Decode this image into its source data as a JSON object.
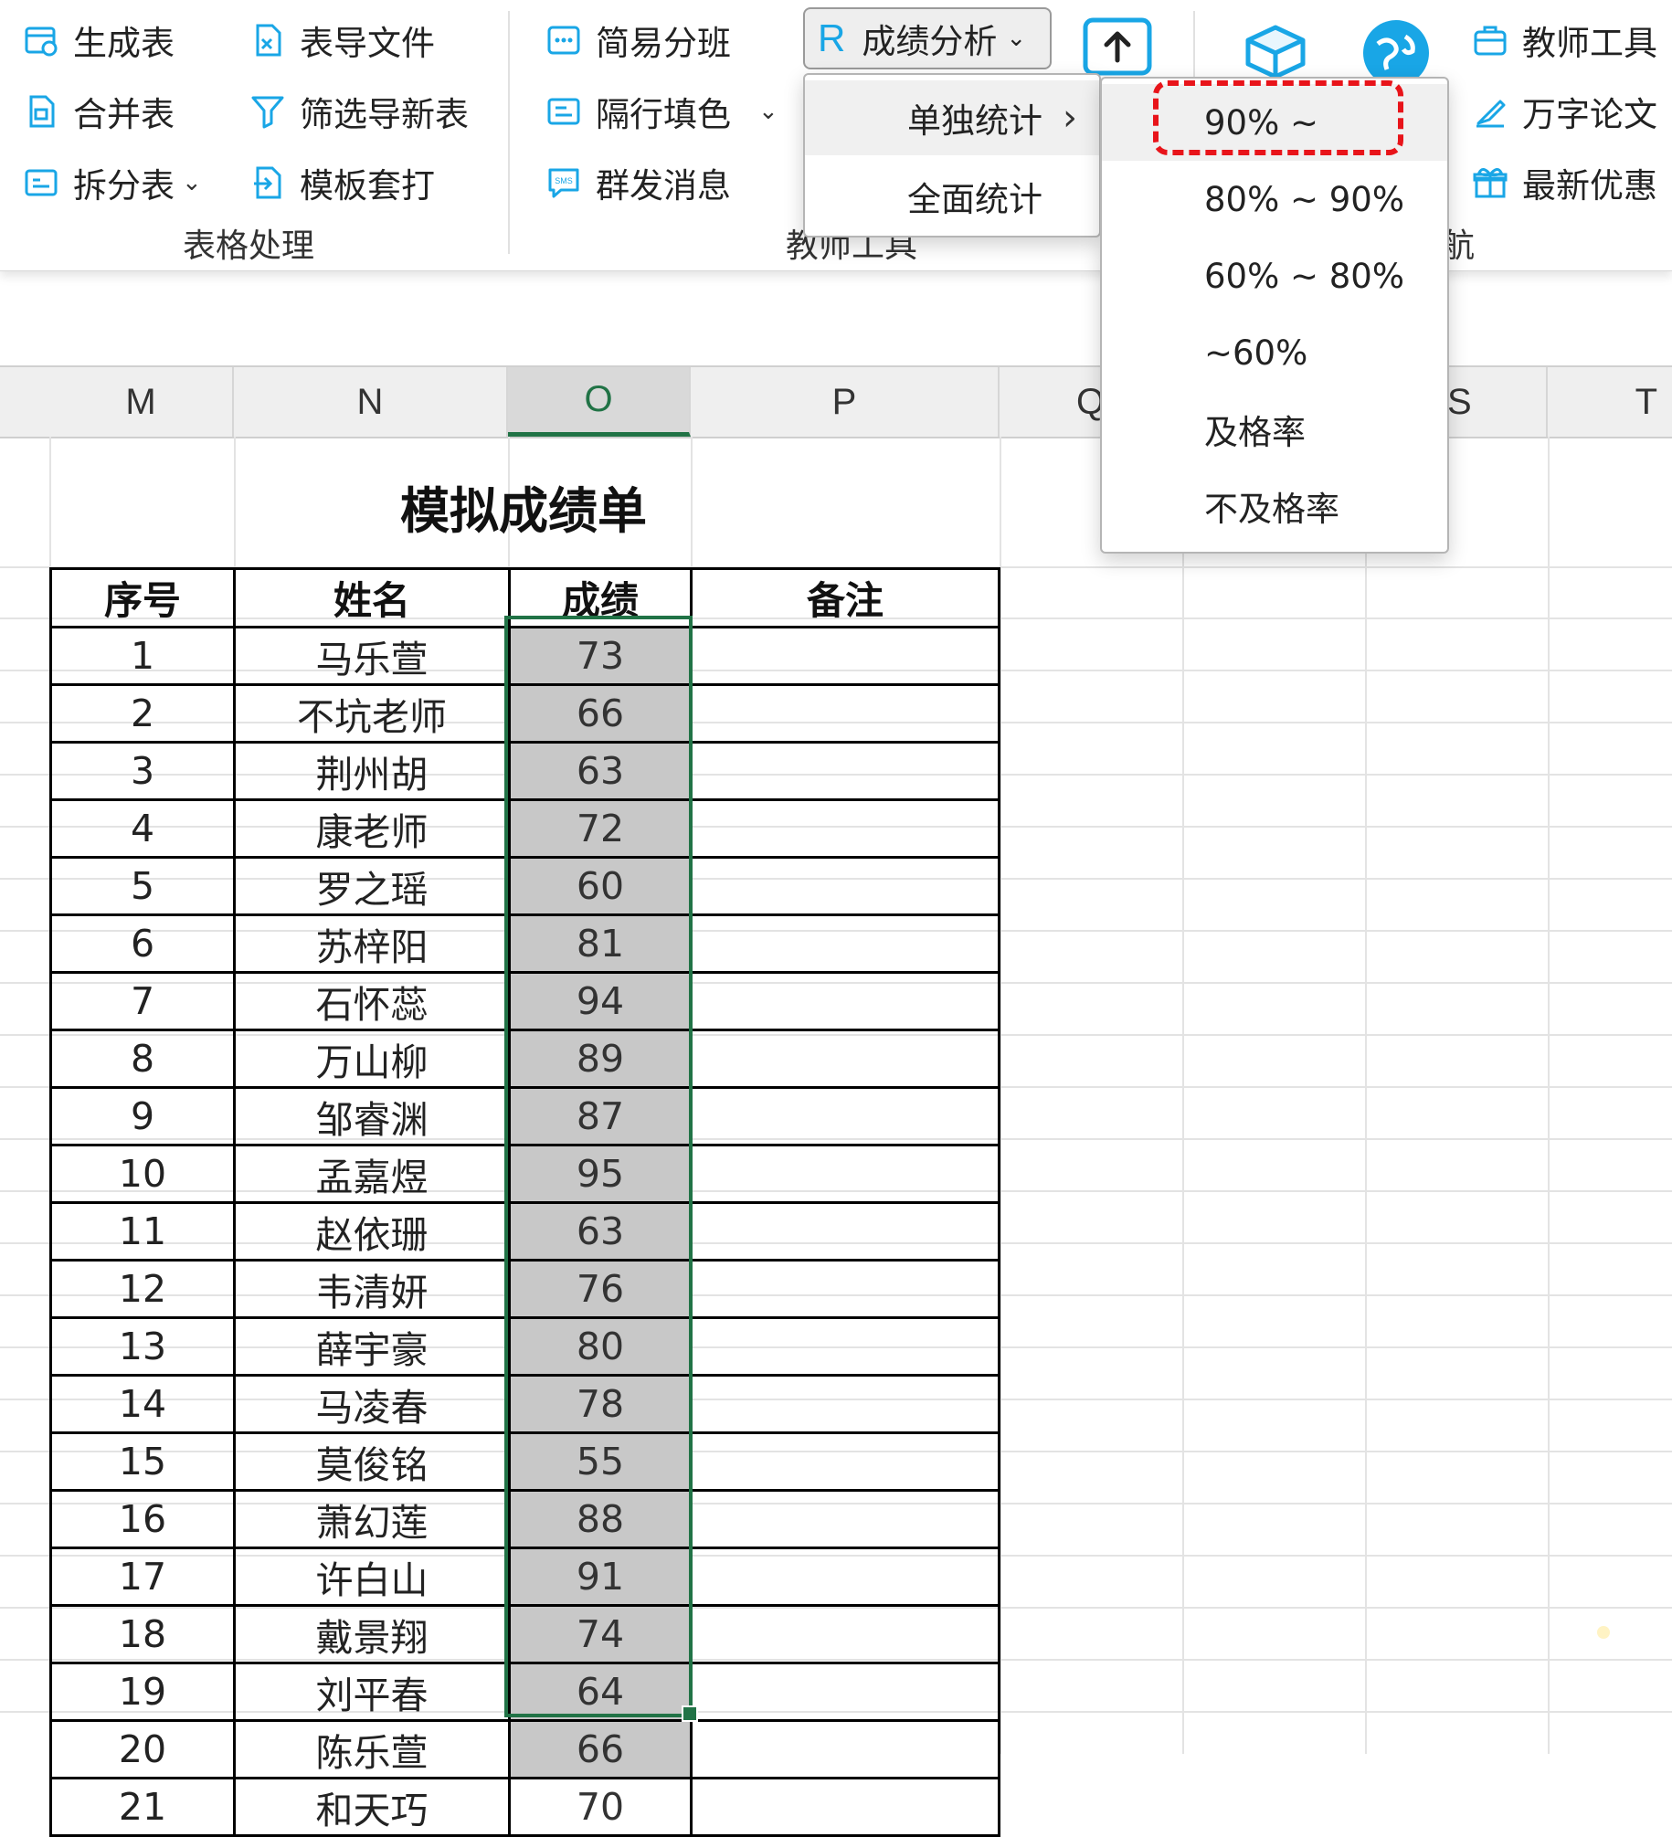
{
  "ribbon": {
    "table_group": {
      "items": [
        {
          "label": "生成表",
          "icon": "generate-table-icon"
        },
        {
          "label": "表导文件",
          "icon": "export-file-icon"
        },
        {
          "label": "合并表",
          "icon": "merge-table-icon"
        },
        {
          "label": "筛选导新表",
          "icon": "filter-icon"
        },
        {
          "label": "拆分表",
          "icon": "split-table-icon"
        },
        {
          "label": "模板套打",
          "icon": "template-print-icon"
        }
      ],
      "label": "表格处理"
    },
    "teacher_group": {
      "items": [
        {
          "label": "简易分班",
          "icon": "class-split-icon"
        },
        {
          "label": "隔行填色",
          "icon": "row-fill-icon"
        },
        {
          "label": "群发消息",
          "icon": "sms-icon"
        }
      ],
      "score_analysis": "成绩分析",
      "score_icon": "R",
      "label": "教师工具"
    },
    "right_group": {
      "items": [
        {
          "label": "教师工具",
          "icon": "briefcase-icon"
        },
        {
          "label": "万字论文",
          "icon": "paper-pen-icon"
        },
        {
          "label": "最新优惠",
          "icon": "gift-icon"
        }
      ],
      "label_partial": "航"
    },
    "colors": {
      "accent": "#19a6e6",
      "select_green": "#217346",
      "highlight_red": "#e8141a"
    }
  },
  "columns": [
    "M",
    "N",
    "O",
    "P",
    "Q",
    "S",
    "T"
  ],
  "sheet": {
    "title": "模拟成绩单",
    "headers": [
      "序号",
      "姓名",
      "成绩",
      "备注"
    ],
    "rows": [
      {
        "no": "1",
        "name": "马乐萱",
        "score": "73"
      },
      {
        "no": "2",
        "name": "不坑老师",
        "score": "66"
      },
      {
        "no": "3",
        "name": "荆州胡",
        "score": "63"
      },
      {
        "no": "4",
        "name": "康老师",
        "score": "72"
      },
      {
        "no": "5",
        "name": "罗之瑶",
        "score": "60"
      },
      {
        "no": "6",
        "name": "苏梓阳",
        "score": "81"
      },
      {
        "no": "7",
        "name": "石怀蕊",
        "score": "94"
      },
      {
        "no": "8",
        "name": "万山柳",
        "score": "89"
      },
      {
        "no": "9",
        "name": "邹睿渊",
        "score": "87"
      },
      {
        "no": "10",
        "name": "孟嘉煜",
        "score": "95"
      },
      {
        "no": "11",
        "name": "赵依珊",
        "score": "63"
      },
      {
        "no": "12",
        "name": "韦清妍",
        "score": "76"
      },
      {
        "no": "13",
        "name": "薛宇豪",
        "score": "80"
      },
      {
        "no": "14",
        "name": "马凌春",
        "score": "78"
      },
      {
        "no": "15",
        "name": "莫俊铭",
        "score": "55"
      },
      {
        "no": "16",
        "name": "萧幻莲",
        "score": "88"
      },
      {
        "no": "17",
        "name": "许白山",
        "score": "91"
      },
      {
        "no": "18",
        "name": "戴景翔",
        "score": "74"
      },
      {
        "no": "19",
        "name": "刘平春",
        "score": "64"
      },
      {
        "no": "20",
        "name": "陈乐萱",
        "score": "66"
      },
      {
        "no": "21",
        "name": "和天巧",
        "score": "70"
      }
    ]
  },
  "menu_level1": [
    {
      "label": "单独统计",
      "has_submenu": true
    },
    {
      "label": "全面统计",
      "has_submenu": false
    }
  ],
  "menu_level2": [
    "90% ~",
    "80% ~ 90%",
    "60% ~ 80%",
    "~60%",
    "及格率",
    "不及格率"
  ]
}
